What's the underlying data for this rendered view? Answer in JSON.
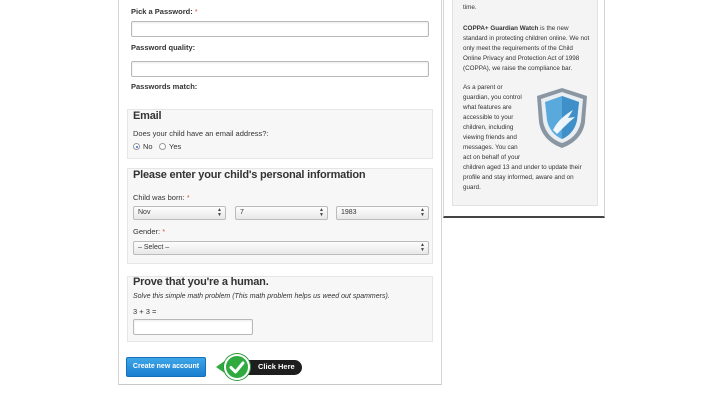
{
  "form": {
    "password_label": "Pick a Password:",
    "required_mark": "*",
    "password_quality_label": "Password quality:",
    "passwords_match_label": "Passwords match:",
    "email_section": {
      "title": "Email",
      "question": "Does your child have an email address?:",
      "options": [
        "No",
        "Yes"
      ],
      "selected": "No"
    },
    "personal_section": {
      "title": "Please enter your child's personal information",
      "born_label": "Child was born:",
      "month": "Nov",
      "day": "7",
      "year": "1983",
      "gender_label": "Gender:",
      "gender_value": "– Select –"
    },
    "human_section": {
      "title": "Prove that you're a human.",
      "description": "Solve this simple math problem (This math problem helps us weed out spammers).",
      "problem": "3 + 3 ="
    },
    "create_button": "Create new account",
    "click_here": "Click Here"
  },
  "sidebar": {
    "top_line": "time.",
    "para1_bold": "COPPA+ Guardian Watch",
    "para1_lines": [
      " is the new",
      "standard in protecting children online. We not",
      "only meet the requirements of the Child",
      "Online Privacy and Protection Act of 1998",
      "(COPPA), we raise the compliance bar."
    ],
    "para2_lines": [
      "As a parent or",
      "guardian, you control",
      "what features are",
      "accessible to your",
      "children, including",
      "viewing friends and",
      "messages. You can"
    ],
    "para2_tail": [
      "act on behalf of your",
      "children aged 13 and under to update their",
      "profile and stay informed, aware and on",
      "guard."
    ],
    "shield_icon": "shield-icon"
  },
  "colors": {
    "accent_blue": "#1a7fd0",
    "check_green": "#2eaa3e",
    "shield_blue": "#5aa9dc"
  }
}
